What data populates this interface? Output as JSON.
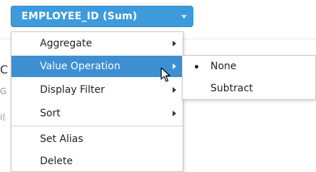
{
  "measure_pill": {
    "label": "EMPLOYEE_ID (Sum)",
    "caret_icon": "chevron-down-icon"
  },
  "background": {
    "fragment_1": "C",
    "fragment_2": "G",
    "fragment_3": "i("
  },
  "context_menu": {
    "items": [
      {
        "label": "Aggregate",
        "has_submenu": true,
        "active": false
      },
      {
        "label": "Value Operation",
        "has_submenu": true,
        "active": true
      },
      {
        "label": "Display Filter",
        "has_submenu": true,
        "active": false
      },
      {
        "label": "Sort",
        "has_submenu": true,
        "active": false
      },
      {
        "label": "Set Alias",
        "has_submenu": false,
        "active": false
      },
      {
        "label": "Delete",
        "has_submenu": false,
        "active": false
      }
    ]
  },
  "value_operation_submenu": {
    "items": [
      {
        "label": "None",
        "selected": true
      },
      {
        "label": "Subtract",
        "selected": false
      }
    ]
  },
  "colors": {
    "pill_blue": "#3d9bdc",
    "highlight_blue": "#3d8fd2"
  }
}
